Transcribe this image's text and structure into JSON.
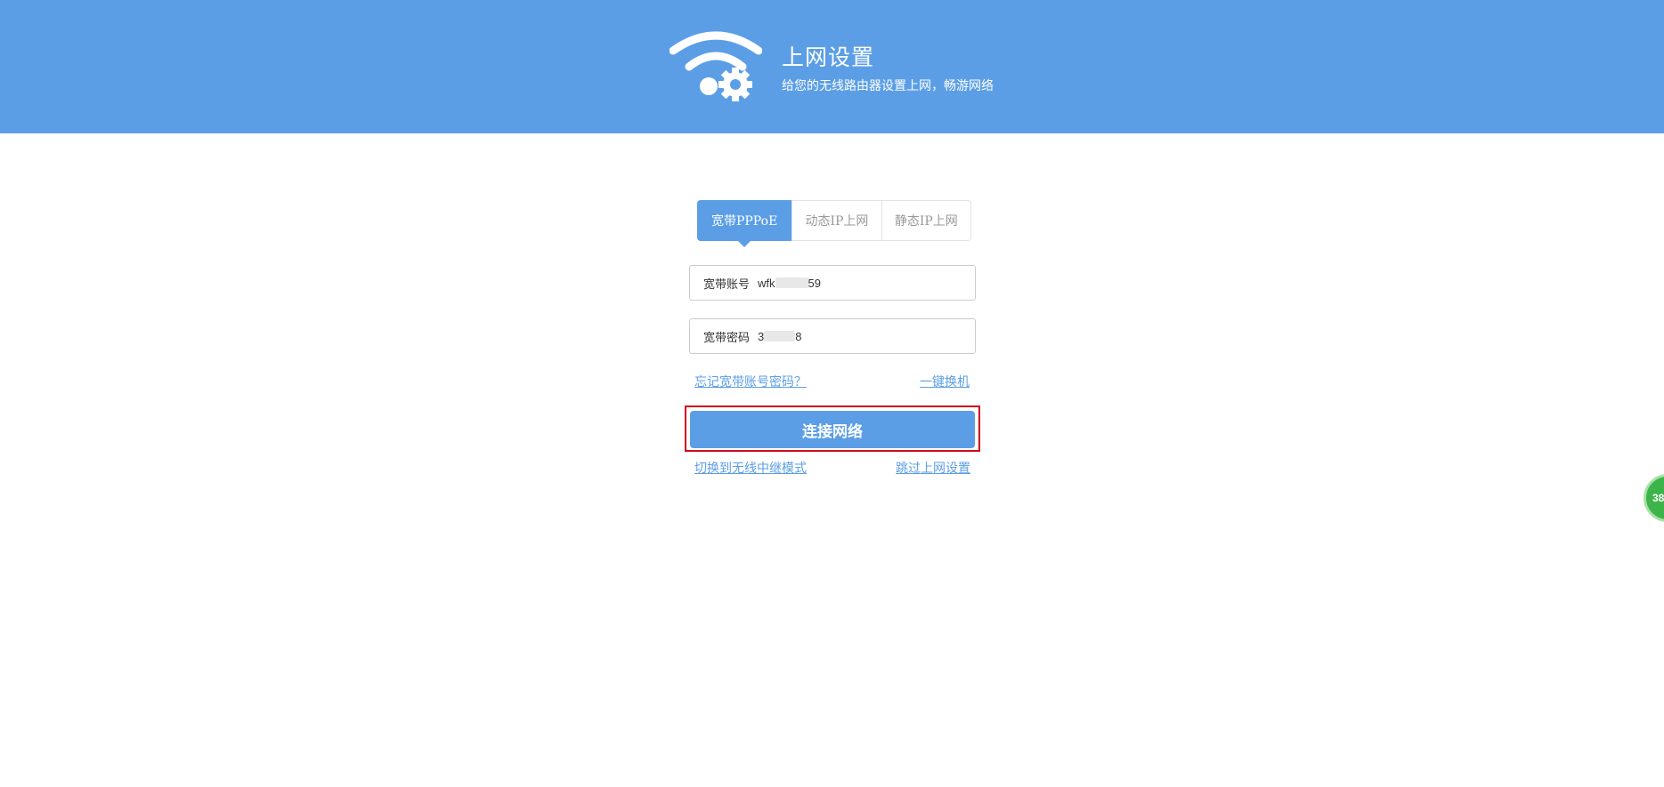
{
  "header": {
    "title": "上网设置",
    "subtitle": "给您的无线路由器设置上网，畅游网络",
    "background_color": "#5b9ee6",
    "logo_icon": "wifi-gear-icon"
  },
  "tabs": [
    {
      "label": "宽带PPPoE",
      "active": true
    },
    {
      "label": "动态IP上网",
      "active": false
    },
    {
      "label": "静态IP上网",
      "active": false
    }
  ],
  "account": {
    "label": "宽带账号",
    "value_prefix": "wfk",
    "value_suffix": "59"
  },
  "password": {
    "label": "宽带密码",
    "value_prefix": "3",
    "value_suffix": "8"
  },
  "links": {
    "forgot": "忘记宽带账号密码？",
    "one_key_swap": "一键换机",
    "switch_repeater": "切换到无线中继模式",
    "skip_setup": "跳过上网设置"
  },
  "connect_button": {
    "label": "连接网络",
    "highlight_color": "#d0021b"
  },
  "side_badge": {
    "text": "38",
    "color": "#3cb44a"
  }
}
